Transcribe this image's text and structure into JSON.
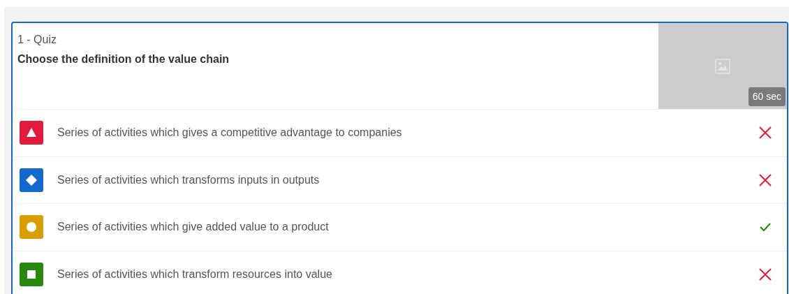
{
  "question": {
    "label": "1 - Quiz",
    "title": "Choose the definition of the value chain",
    "timer": "60 sec"
  },
  "answers": [
    {
      "kind": "triangle",
      "color": "#e21b3c",
      "text": "Series of activities which gives a competitive advantage to companies",
      "correct": false
    },
    {
      "kind": "diamond",
      "color": "#1368ce",
      "text": "Series of activities which transforms inputs in outputs",
      "correct": false
    },
    {
      "kind": "circle",
      "color": "#d89e00",
      "text": "Series of activities which give added value to a product",
      "correct": true
    },
    {
      "kind": "square",
      "color": "#26890c",
      "text": "Series of activities which transform resources into value",
      "correct": false
    }
  ]
}
